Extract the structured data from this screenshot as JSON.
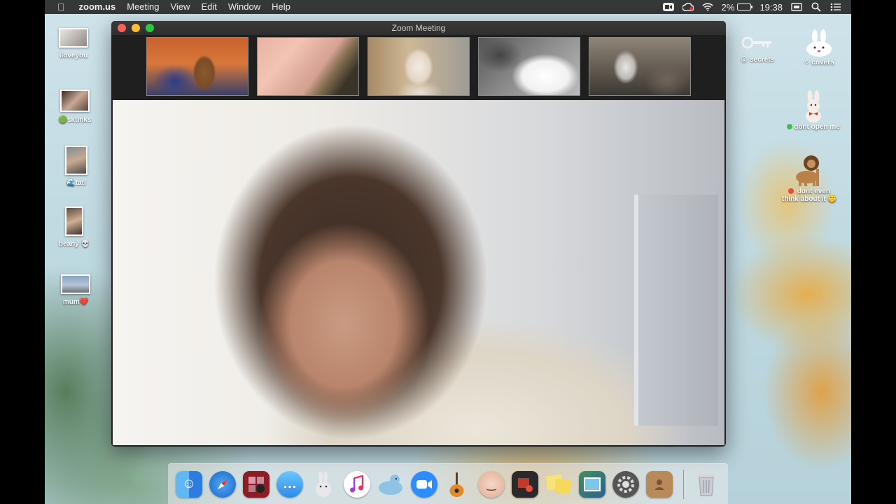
{
  "menubar": {
    "apple_glyph": "",
    "app_name": "zoom.us",
    "menus": [
      "Meeting",
      "View",
      "Edit",
      "Window",
      "Help"
    ],
    "battery_percent": "2%",
    "battery_level": 0.02,
    "clock": "19:38",
    "status_icons": [
      "zoom-status-icon",
      "creative-cloud-icon",
      "wifi-icon",
      "battery-icon",
      "screen-mirror-icon",
      "spotlight-search-icon",
      "notification-center-icon"
    ]
  },
  "desktop_left": [
    {
      "label": "iloveyou",
      "emoji": ""
    },
    {
      "label": "skunks",
      "emoji": "🟢"
    },
    {
      "label": "tati",
      "emoji": "🌊"
    },
    {
      "label": "beany",
      "emoji": "💀"
    },
    {
      "label": "mum",
      "emoji": "❤️"
    }
  ],
  "desktop_right": [
    {
      "label": "secrets",
      "emoji": "😮"
    },
    {
      "label": "covers",
      "emoji": "⚪"
    },
    {
      "label": "dont open me",
      "emoji": "🟢"
    },
    {
      "label": "dont even think about it",
      "emoji": "🤫"
    }
  ],
  "zoom_window": {
    "title": "Zoom Meeting",
    "participants": [
      "dog-dachshund",
      "blurred-hand",
      "dog-terrier",
      "dog-fluffy",
      "dog-husky"
    ]
  },
  "dock": {
    "apps": [
      "Finder",
      "Safari",
      "Photo Booth",
      "Messages",
      "Rabbit App",
      "iTunes",
      "Sequel Pro",
      "Zoom",
      "GarageBand",
      "Face App",
      "Slides App",
      "Stickies",
      "Preview",
      "System Preferences",
      "Contacts"
    ],
    "trash": "Trash"
  }
}
